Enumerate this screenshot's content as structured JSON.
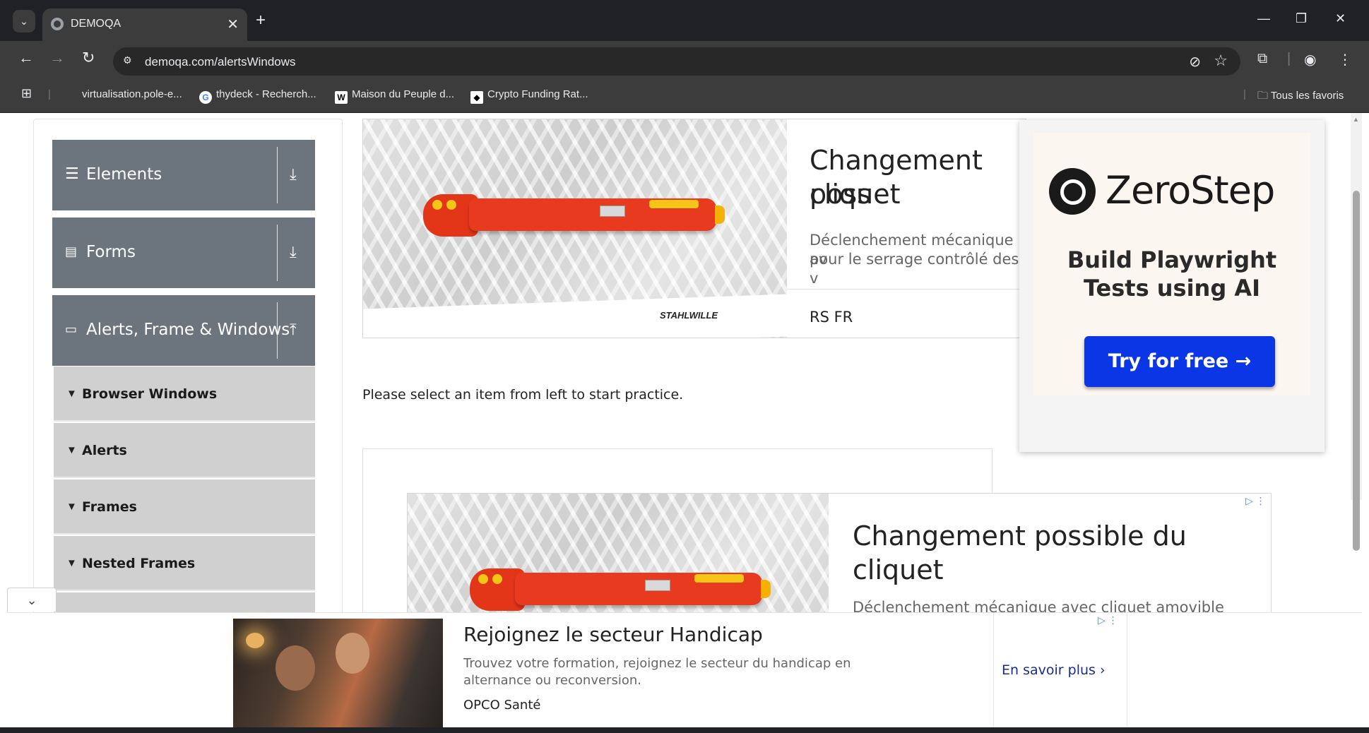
{
  "browser": {
    "tab_title": "DEMOQA",
    "url": "demoqa.com/alertsWindows",
    "new_tab": "+",
    "tab_close": "✕",
    "bookmarks": [
      {
        "label": "virtualisation.pole-e...",
        "icon": "none"
      },
      {
        "label": "thydeck - Recherch...",
        "icon": "google-icon"
      },
      {
        "label": "Maison du Peuple d...",
        "icon": "wikipedia-icon"
      },
      {
        "label": "Crypto Funding Rat...",
        "icon": "site-icon"
      }
    ],
    "all_bookmarks": "Tous les favoris"
  },
  "sidebar": {
    "groups": [
      {
        "label": "Elements",
        "icon": "hamburger-icon",
        "arrow": "download-icon"
      },
      {
        "label": "Forms",
        "icon": "document-icon",
        "arrow": "download-icon"
      },
      {
        "label": "Alerts, Frame & Windows",
        "icon": "window-icon",
        "arrow": "upload-icon"
      }
    ],
    "items": [
      "Browser Windows",
      "Alerts",
      "Frames",
      "Nested Frames"
    ]
  },
  "ad_top": {
    "headline": "Changement possible du cliquet",
    "headline_visible": "Changement poss",
    "headline_line2": "cliquet",
    "desc_line1": "Déclenchement mécanique av",
    "desc_line2": "pour le serrage contrôlé des v",
    "advertiser": "RS FR",
    "brand": "STAHLWILLE"
  },
  "practice_text": "Please select an item from left to start practice.",
  "ad_middle": {
    "headline_line1": "Changement possible du",
    "headline_line2": "cliquet",
    "desc": "Déclenchement mécanique avec cliquet amovible"
  },
  "zerostep": {
    "brand": "ZeroStep",
    "tagline_line1": "Build Playwright",
    "tagline_line2": "Tests using AI",
    "cta": "Try for free →"
  },
  "bottom_ad": {
    "headline": "Rejoignez le secteur Handicap",
    "desc": "Trouvez votre formation, rejoignez le secteur du handicap en alternance ou reconversion.",
    "advertiser": "OPCO Santé",
    "cta": "En savoir plus"
  },
  "colors": {
    "sidebar_header": "#6c757d",
    "sidebar_item": "#d0d0d0",
    "cta_blue": "#0a36e6",
    "wrench_red": "#e83a1e"
  }
}
